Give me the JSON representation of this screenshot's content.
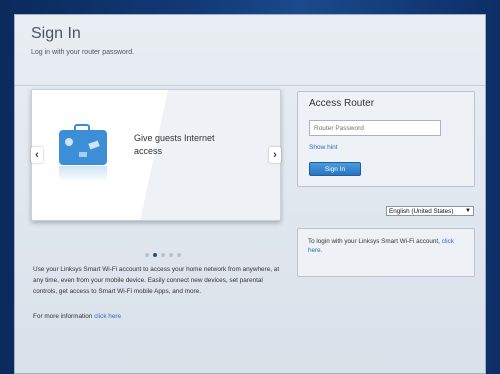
{
  "header": {
    "title": "Sign In",
    "subtitle": "Log in with your router password."
  },
  "carousel": {
    "slide_text": "Give guests Internet access",
    "slide_icon": "suitcase-icon",
    "prev_arrow": "‹",
    "next_arrow": "›",
    "dots_total": 5,
    "active_dot": 2
  },
  "description": "Use your Linksys Smart Wi-Fi account to access your home network from anywhere, at any time, even from your mobile device. Easily connect new devices, set parental controls, get access to Smart Wi-Fi mobile Apps, and more.",
  "more_info": {
    "prefix": "For more information ",
    "link": "click here"
  },
  "login": {
    "title": "Access Router",
    "password_placeholder": "Router Password",
    "show_hint": "Show hint",
    "sign_in_label": "Sign In"
  },
  "language": {
    "selected": "English (United States)",
    "caret": "▼"
  },
  "note": {
    "text": "To login with your Linksys Smart Wi-Fi account, ",
    "link": "click here."
  },
  "colors": {
    "accent": "#2a73bd",
    "link": "#2a6cbf",
    "background": "#123a78"
  }
}
